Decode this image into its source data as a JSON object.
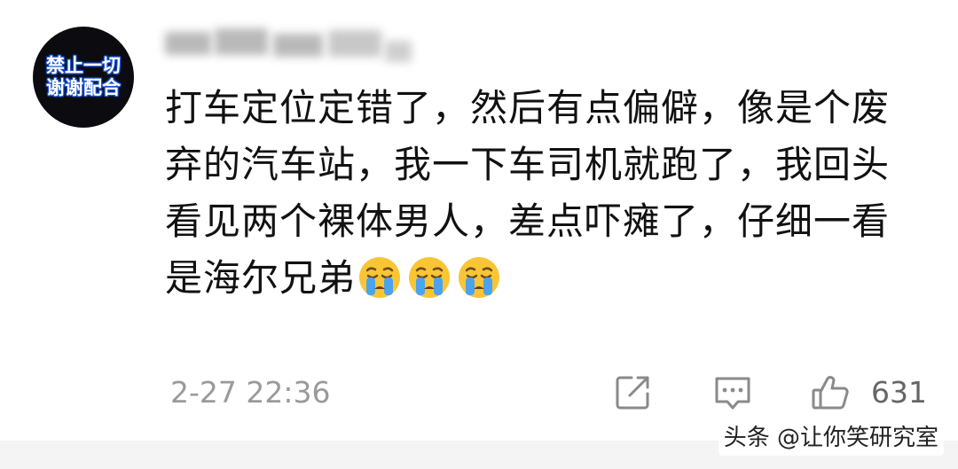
{
  "user": {
    "avatar_lines": [
      "禁止一切",
      "谢谢配合"
    ]
  },
  "comment": {
    "lines": [
      "打车定位定错了，然后有点偏僻，像是个废",
      "弃的汽车站，我一下车司机就跑了，我回头",
      "看见两个裸体男人，差点吓瘫了，仔细一看",
      "是海尔兄弟"
    ],
    "emojis": [
      "crying-face-icon",
      "crying-face-icon",
      "crying-face-icon"
    ]
  },
  "footer": {
    "timestamp": "2-27 22:36",
    "like_count": "631"
  },
  "watermark": {
    "text": "头条 @让你笑研究室"
  },
  "colors": {
    "avatar_bg": "#0c0c10",
    "avatar_outline": "#1a56d6",
    "text": "#111111",
    "meta": "#9a9a9a",
    "emoji_yellow": "#f9c534",
    "tears_blue": "#4aa3ee"
  }
}
